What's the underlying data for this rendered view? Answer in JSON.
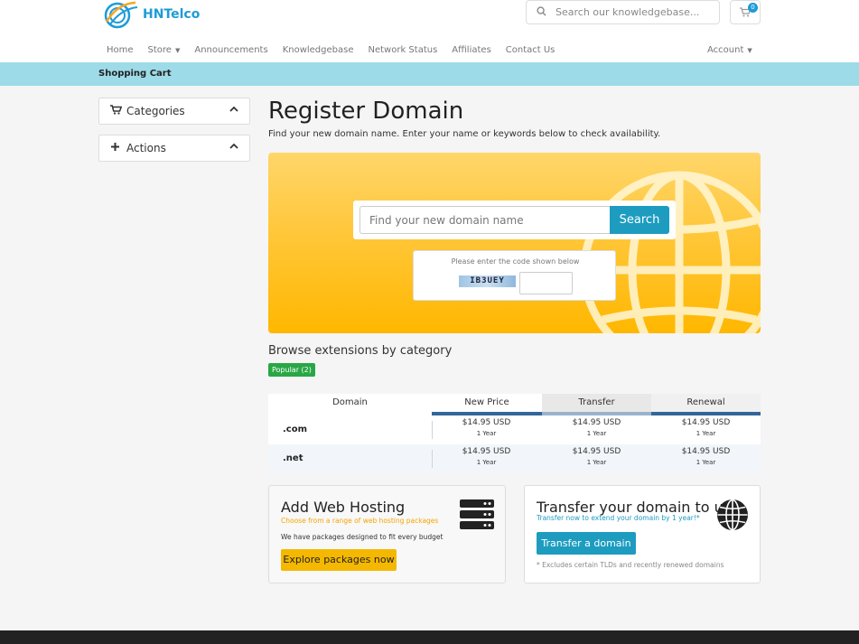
{
  "brand": {
    "name": "HNTelco",
    "accent": "#1e9bd7"
  },
  "search": {
    "placeholder": "Search our knowledgebase..."
  },
  "cart": {
    "count": "0"
  },
  "nav": {
    "items": [
      {
        "label": "Home"
      },
      {
        "label": "Store",
        "dropdown": true
      },
      {
        "label": "Announcements"
      },
      {
        "label": "Knowledgebase"
      },
      {
        "label": "Network Status"
      },
      {
        "label": "Affiliates"
      },
      {
        "label": "Contact Us"
      }
    ],
    "account_label": "Account"
  },
  "breadcrumb": {
    "label": "Shopping Cart"
  },
  "sidebar": {
    "panels": [
      {
        "label": "Categories",
        "icon": "cart-icon"
      },
      {
        "label": "Actions",
        "icon": "plus-icon"
      }
    ]
  },
  "main": {
    "title": "Register Domain",
    "subtitle": "Find your new domain name. Enter your name or keywords below to check availability.",
    "domain_search": {
      "placeholder": "Find your new domain name",
      "button_label": "Search"
    },
    "captcha": {
      "prompt": "Please enter the code shown below",
      "code": "IB3UEY"
    },
    "browse_title": "Browse extensions by category",
    "popular_badge": "Popular (2)",
    "table": {
      "headers": {
        "domain": "Domain",
        "new_price": "New Price",
        "transfer": "Transfer",
        "renewal": "Renewal"
      },
      "rows": [
        {
          "tld": ".com",
          "new_price": "$14.95 USD",
          "transfer": "$14.95 USD",
          "renewal": "$14.95 USD",
          "period": "1 Year"
        },
        {
          "tld": ".net",
          "new_price": "$14.95 USD",
          "transfer": "$14.95 USD",
          "renewal": "$14.95 USD",
          "period": "1 Year"
        }
      ]
    },
    "hosting_promo": {
      "title": "Add Web Hosting",
      "tagline": "Choose from a range of web hosting packages",
      "text": "We have packages designed to fit every budget",
      "button": "Explore packages now"
    },
    "transfer_promo": {
      "title": "Transfer your domain to us",
      "tagline": "Transfer now to extend your domain by 1 year!*",
      "button": "Transfer a domain",
      "note": "* Excludes certain TLDs and recently renewed domains"
    }
  },
  "colors": {
    "hero": "#ffc534",
    "primary_button": "#1d9cc0",
    "badge": "#28a745",
    "hosting_button": "#f5b800",
    "hosting_tagline": "#f5a500",
    "transfer_tagline": "#1d9cc0"
  }
}
